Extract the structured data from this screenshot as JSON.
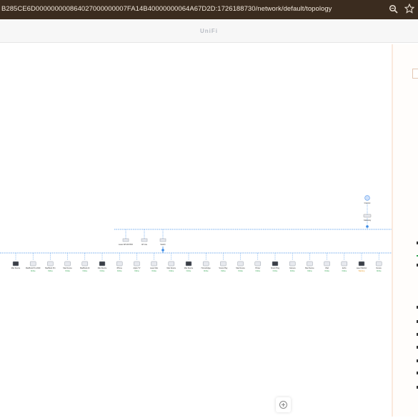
{
  "browser": {
    "url": "B285CE6D000000000864027000000007FA14B40000000064A67D2D:1726188730/network/default/topology",
    "zoom_icon": "zoom-icon",
    "bookmark_icon": "star-icon"
  },
  "app": {
    "title": "UniFi"
  },
  "colors": {
    "link": "#3b8be6",
    "online": "#2ba24c",
    "warning": "#e89a23",
    "accent": "#3b8be6"
  },
  "topology": {
    "internet": {
      "label": "Internet",
      "icon": "globe-icon"
    },
    "gateway": {
      "label": "Gateway",
      "icon": "gateway-icon"
    },
    "upper_devices": [
      {
        "name": "Laser AP/U6 PRO",
        "status": "",
        "icon": "device-icon"
      },
      {
        "name": "AP Lite",
        "status": "",
        "icon": "device-icon"
      },
      {
        "name": "Switch",
        "status": "",
        "icon": "switch-icon"
      }
    ],
    "clients": [
      {
        "name": "Mac Device",
        "status": "",
        "icon": "device-icon"
      },
      {
        "name": "MacBook Pro 2020",
        "status": "Online",
        "icon": "laptop-icon"
      },
      {
        "name": "MacBook Pro",
        "status": "Online",
        "icon": "laptop-icon"
      },
      {
        "name": "Mac Device",
        "status": "Online",
        "icon": "device-icon"
      },
      {
        "name": "MacBook Air",
        "status": "Online",
        "icon": "laptop-icon"
      },
      {
        "name": "Mac Device",
        "status": "Online",
        "icon": "device-icon"
      },
      {
        "name": "iPhone",
        "status": "Online",
        "icon": "phone-icon"
      },
      {
        "name": "Apple TV",
        "status": "Online",
        "icon": "tv-icon"
      },
      {
        "name": "Laser Mac",
        "status": "Online",
        "icon": "device-icon"
      },
      {
        "name": "Mac Device",
        "status": "Online",
        "icon": "device-icon"
      },
      {
        "name": "Mac Device",
        "status": "Online",
        "icon": "device-icon"
      },
      {
        "name": "Homebridge",
        "status": "Online",
        "icon": "device-icon"
      },
      {
        "name": "Sonos Play",
        "status": "Online",
        "icon": "speaker-icon"
      },
      {
        "name": "Mac Device",
        "status": "Online",
        "icon": "device-icon"
      },
      {
        "name": "Printer",
        "status": "Online",
        "icon": "printer-icon"
      },
      {
        "name": "Smart Plug",
        "status": "Online",
        "icon": "plug-icon"
      },
      {
        "name": "Camera",
        "status": "Online",
        "icon": "camera-icon"
      },
      {
        "name": "Mac Device",
        "status": "Online",
        "icon": "device-icon"
      },
      {
        "name": "iPad",
        "status": "Online",
        "icon": "tablet-icon"
      },
      {
        "name": "Echo",
        "status": "Online",
        "icon": "speaker-icon"
      },
      {
        "name": "Laser Monitor",
        "status": "Warning",
        "icon": "monitor-icon"
      },
      {
        "name": "Device",
        "status": "Online",
        "icon": "device-icon"
      }
    ]
  },
  "zoom_control": {
    "icon": "zoom-in-icon"
  }
}
